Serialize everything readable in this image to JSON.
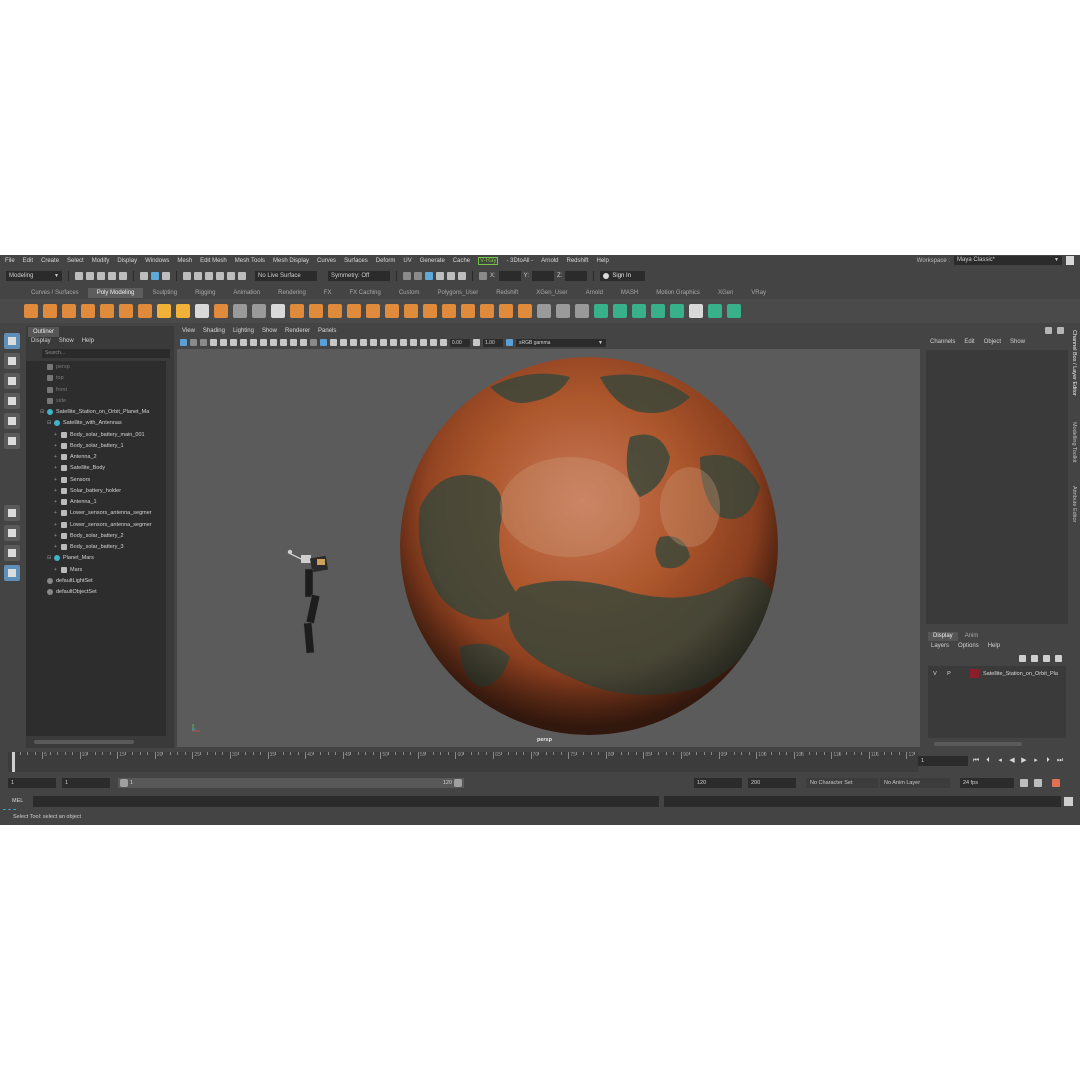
{
  "menubar": {
    "items": [
      "File",
      "Edit",
      "Create",
      "Select",
      "Modify",
      "Display",
      "Windows",
      "Mesh",
      "Edit Mesh",
      "Mesh Tools",
      "Mesh Display",
      "Curves",
      "Surfaces",
      "Deform",
      "UV",
      "Generate",
      "Cache",
      "V-Ray",
      "- 3DtoAll -",
      "Arnold",
      "Redshift",
      "Help"
    ],
    "workspace_label": "Workspace :",
    "workspace_value": "Maya Classic*"
  },
  "statusline": {
    "mode": "Modeling",
    "live_surface": "No Live Surface",
    "symmetry": "Symmetry: Off",
    "x_label": "X:",
    "y_label": "Y:",
    "z_label": "Z:",
    "sign_in": "Sign In"
  },
  "shelf": {
    "tabs": [
      "Curves / Surfaces",
      "Poly Modeling",
      "Sculpting",
      "Rigging",
      "Animation",
      "Rendering",
      "FX",
      "FX Caching",
      "Custom",
      "Polygons_User",
      "Redshift",
      "XGen_User",
      "Arnold",
      "MASH",
      "Motion Graphics",
      "XGen",
      "VRay"
    ],
    "active_tab": "Poly Modeling"
  },
  "outliner": {
    "tab": "Outliner",
    "menu": [
      "Display",
      "Show",
      "Help"
    ],
    "search_placeholder": "Search...",
    "rows": [
      {
        "label": "persp",
        "type": "camera",
        "depth": 0,
        "dim": true
      },
      {
        "label": "top",
        "type": "camera",
        "depth": 0,
        "dim": true
      },
      {
        "label": "front",
        "type": "camera",
        "depth": 0,
        "dim": true
      },
      {
        "label": "side",
        "type": "camera",
        "depth": 0,
        "dim": true
      },
      {
        "label": "Satellite_Station_on_Orbit_Planet_Ma",
        "type": "group",
        "depth": 0,
        "expander": "⊟"
      },
      {
        "label": "Satellite_with_Antennas",
        "type": "group",
        "depth": 1,
        "expander": "⊟"
      },
      {
        "label": "Body_solar_battery_main_001",
        "type": "mesh",
        "depth": 2,
        "expander": "+"
      },
      {
        "label": "Body_solar_battery_1",
        "type": "mesh",
        "depth": 2,
        "expander": "+"
      },
      {
        "label": "Antenna_2",
        "type": "mesh",
        "depth": 2,
        "expander": "+"
      },
      {
        "label": "Satellite_Body",
        "type": "mesh",
        "depth": 2,
        "expander": "+"
      },
      {
        "label": "Sensors",
        "type": "mesh",
        "depth": 2,
        "expander": "+"
      },
      {
        "label": "Solar_battery_holder",
        "type": "mesh",
        "depth": 2,
        "expander": "+"
      },
      {
        "label": "Antenna_1",
        "type": "mesh",
        "depth": 2,
        "expander": "+"
      },
      {
        "label": "Lower_sensors_antenna_segmer",
        "type": "mesh",
        "depth": 2,
        "expander": "+"
      },
      {
        "label": "Lower_sensors_antenna_segmer",
        "type": "mesh",
        "depth": 2,
        "expander": "+"
      },
      {
        "label": "Body_solar_battery_2",
        "type": "mesh",
        "depth": 2,
        "expander": "+"
      },
      {
        "label": "Body_solar_battery_3",
        "type": "mesh",
        "depth": 2,
        "expander": "+"
      },
      {
        "label": "Planet_Mars",
        "type": "group",
        "depth": 1,
        "expander": "⊟"
      },
      {
        "label": "Mars",
        "type": "mesh",
        "depth": 2,
        "expander": "+"
      },
      {
        "label": "defaultLightSet",
        "type": "set",
        "depth": 0
      },
      {
        "label": "defaultObjectSet",
        "type": "set",
        "depth": 0
      }
    ]
  },
  "viewport": {
    "menu": [
      "View",
      "Shading",
      "Lighting",
      "Show",
      "Renderer",
      "Panels"
    ],
    "exposure": "0.00",
    "gamma": "1.00",
    "colorspace": "sRGB gamma",
    "camera_label": "persp"
  },
  "channelbox": {
    "menu": [
      "Channels",
      "Edit",
      "Object",
      "Show"
    ]
  },
  "side_tabs": [
    "Channel Box / Layer Editor",
    "Modelling Toolkit",
    "Attribute Editor"
  ],
  "layer_editor": {
    "tabs": [
      "Display",
      "Anim"
    ],
    "active_tab": "Display",
    "menu": [
      "Layers",
      "Options",
      "Help"
    ],
    "layers": [
      {
        "visible": "V",
        "playback": "P",
        "color": "#8c1e2b",
        "name": "Satellite_Station_on_Orbit_Pla"
      }
    ]
  },
  "timeline": {
    "tick_labels": [
      "5",
      "10",
      "15",
      "20",
      "25",
      "30",
      "35",
      "40",
      "45",
      "50",
      "55",
      "60",
      "65",
      "70",
      "75",
      "80",
      "85",
      "90",
      "95",
      "100",
      "105",
      "110",
      "115",
      "12"
    ],
    "start_label": "1",
    "current_frame": "1"
  },
  "range": {
    "start": "1",
    "anim_start": "1",
    "range_start_label": "1",
    "range_end_label": "120",
    "end": "120",
    "anim_end": "200",
    "character_set": "No Character Set",
    "anim_layer": "No Anim Layer",
    "fps": "24 fps"
  },
  "cmdline": {
    "label": "MEL"
  },
  "helpline": {
    "text": "Select Tool: select an object"
  },
  "colors": {
    "accent_blue": "#5d8fb8",
    "shelf_orange": "#e08a3c",
    "vray_green": "#7ac143",
    "layer_color": "#8c1e2b"
  }
}
